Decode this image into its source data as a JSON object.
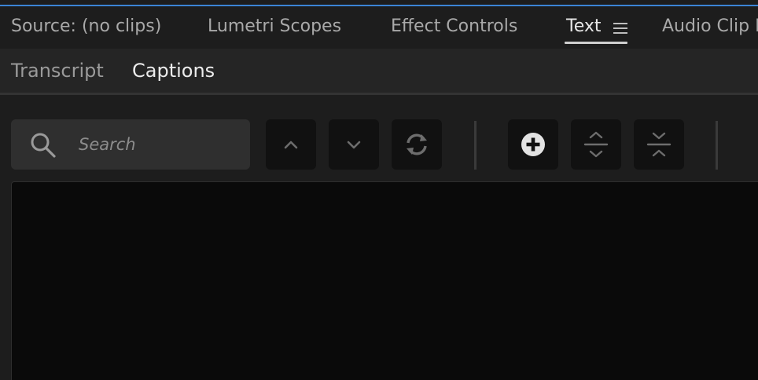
{
  "panel_tabs": [
    {
      "label": "Source: (no clips)",
      "active": false
    },
    {
      "label": "Lumetri Scopes",
      "active": false
    },
    {
      "label": "Effect Controls",
      "active": false
    },
    {
      "label": "Text",
      "active": true
    },
    {
      "label": "Audio Clip M",
      "active": false
    }
  ],
  "text_subtabs": [
    {
      "label": "Transcript",
      "active": false
    },
    {
      "label": "Captions",
      "active": true
    }
  ],
  "search": {
    "placeholder": "Search",
    "value": ""
  },
  "toolbar": {
    "buttons": [
      {
        "icon": "chevron-up-icon",
        "name": "previous-result-button"
      },
      {
        "icon": "chevron-down-icon",
        "name": "next-result-button"
      },
      {
        "icon": "refresh-icon",
        "name": "replace-button"
      },
      {
        "icon": "plus-circle-icon",
        "name": "add-caption-button"
      },
      {
        "icon": "split-caption-icon",
        "name": "split-caption-button"
      },
      {
        "icon": "merge-captions-icon",
        "name": "merge-captions-button"
      }
    ]
  },
  "colors": {
    "accent": "#3b84d6",
    "panel_bg": "#1d1d1d",
    "subtab_bg": "#252525",
    "search_bg": "#2f2f2f",
    "button_bg": "#111111",
    "content_bg": "#0a0a0a"
  }
}
